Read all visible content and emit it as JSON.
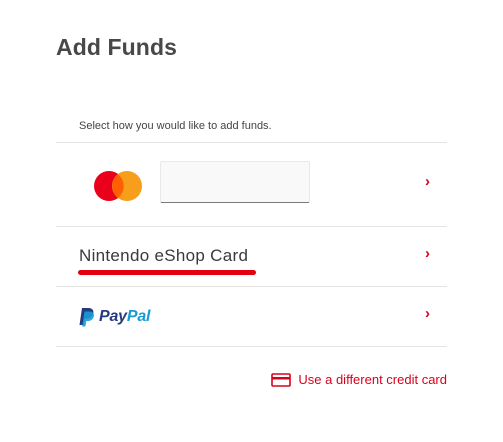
{
  "page": {
    "title": "Add Funds",
    "instruction": "Select how you would like to add funds."
  },
  "payment_methods": {
    "mastercard": {
      "icon": "mastercard-logo-icon",
      "card_field_value": "",
      "card_field_placeholder": ""
    },
    "eshop_card": {
      "label": "Nintendo eShop Card"
    },
    "paypal": {
      "icon": "paypal-logo-icon",
      "brand_dark": "Pay",
      "brand_light": "Pal"
    },
    "chevron_glyph": "›"
  },
  "different_card": {
    "icon": "credit-card-icon",
    "label": "Use a different credit card"
  },
  "colors": {
    "accent": "#d9001b",
    "highlight_underline": "#e3000f",
    "mastercard_red": "#eb001b",
    "mastercard_orange": "#f79e1b",
    "mastercard_overlap": "#ff5f00",
    "paypal_dark": "#253b80",
    "paypal_light": "#179bd7"
  }
}
